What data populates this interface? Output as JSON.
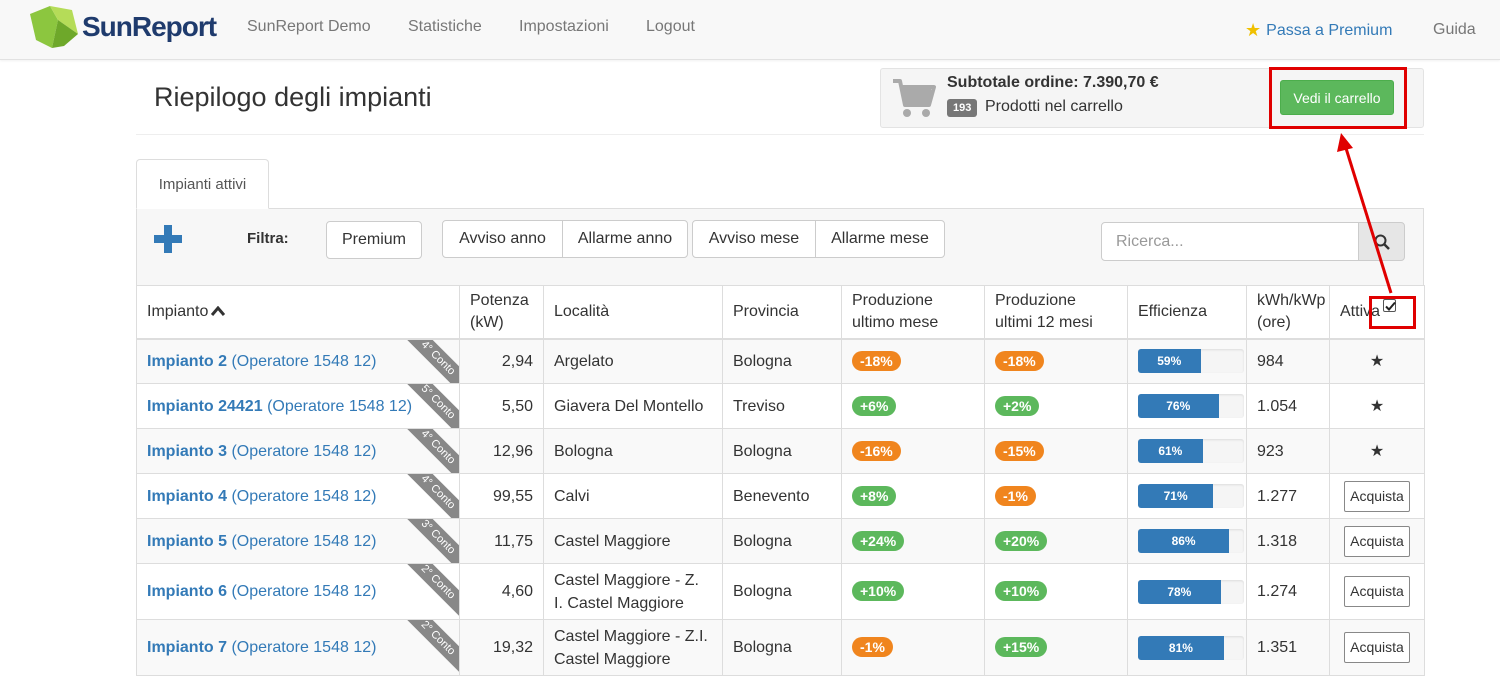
{
  "brand": {
    "name": "SunReport",
    "logo_icon": "sunreport-logo-icon"
  },
  "nav": {
    "items": [
      "SunReport Demo",
      "Statistiche",
      "Impostazioni",
      "Logout"
    ],
    "premium_label": "Passa a Premium",
    "guide_label": "Guida"
  },
  "page": {
    "title": "Riepilogo degli impianti"
  },
  "cart": {
    "subtotal_label": "Subtotale ordine: 7.390,70 €",
    "count": "193",
    "products_label": "Prodotti nel carrello",
    "button_label": "Vedi il carrello"
  },
  "tabs": [
    {
      "label": "Impianti attivi"
    }
  ],
  "filter": {
    "label": "Filtra:",
    "buttons": [
      "Premium",
      "Avviso anno",
      "Allarme anno",
      "Avviso mese",
      "Allarme mese"
    ]
  },
  "search": {
    "placeholder": "Ricerca..."
  },
  "table": {
    "headers": {
      "impianto": "Impianto",
      "potenza": "Potenza (kW)",
      "localita": "Località",
      "provincia": "Provincia",
      "prod_mese": "Produzione ultimo mese",
      "prod_anno": "Produzione ultimi 12 mesi",
      "efficienza": "Efficienza",
      "kwh": "kWh/kWp (ore)",
      "attiva": "Attiva"
    },
    "rows": [
      {
        "name": "Impianto 2",
        "operator": "(Operatore 1548 12)",
        "conto": "4° Conto",
        "potenza": "2,94",
        "localita": "Argelato",
        "provincia": "Bologna",
        "prod_mese": "-18%",
        "prod_anno": "-18%",
        "efficienza": 59,
        "efficienza_label": "59%",
        "kwh": "984",
        "attiva": "star"
      },
      {
        "name": "Impianto 24421",
        "operator": "(Operatore 1548 12)",
        "conto": "5° Conto",
        "potenza": "5,50",
        "localita": "Giavera Del Montello",
        "provincia": "Treviso",
        "prod_mese": "+6%",
        "prod_anno": "+2%",
        "efficienza": 76,
        "efficienza_label": "76%",
        "kwh": "1.054",
        "attiva": "star"
      },
      {
        "name": "Impianto 3",
        "operator": "(Operatore 1548 12)",
        "conto": "4° Conto",
        "potenza": "12,96",
        "localita": "Bologna",
        "provincia": "Bologna",
        "prod_mese": "-16%",
        "prod_anno": "-15%",
        "efficienza": 61,
        "efficienza_label": "61%",
        "kwh": "923",
        "attiva": "star"
      },
      {
        "name": "Impianto 4",
        "operator": "(Operatore 1548 12)",
        "conto": "4° Conto",
        "potenza": "99,55",
        "localita": "Calvi",
        "provincia": "Benevento",
        "prod_mese": "+8%",
        "prod_anno": "-1%",
        "efficienza": 71,
        "efficienza_label": "71%",
        "kwh": "1.277",
        "attiva": "Acquista"
      },
      {
        "name": "Impianto 5",
        "operator": "(Operatore 1548 12)",
        "conto": "3° Conto",
        "potenza": "11,75",
        "localita": "Castel Maggiore",
        "provincia": "Bologna",
        "prod_mese": "+24%",
        "prod_anno": "+20%",
        "efficienza": 86,
        "efficienza_label": "86%",
        "kwh": "1.318",
        "attiva": "Acquista"
      },
      {
        "name": "Impianto 6",
        "operator": "(Operatore 1548 12)",
        "conto": "2° Conto",
        "potenza": "4,60",
        "localita": "Castel Maggiore - Z. I. Castel Maggiore",
        "provincia": "Bologna",
        "prod_mese": "+10%",
        "prod_anno": "+10%",
        "efficienza": 78,
        "efficienza_label": "78%",
        "kwh": "1.274",
        "attiva": "Acquista"
      },
      {
        "name": "Impianto 7",
        "operator": "(Operatore 1548 12)",
        "conto": "2° Conto",
        "potenza": "19,32",
        "localita": "Castel Maggiore - Z.I. Castel Maggiore",
        "provincia": "Bologna",
        "prod_mese": "-1%",
        "prod_anno": "+15%",
        "efficienza": 81,
        "efficienza_label": "81%",
        "kwh": "1.351",
        "attiva": "Acquista"
      }
    ]
  },
  "colors": {
    "accent": "#337ab7",
    "success": "#5cb85c",
    "warning": "#f0851e",
    "highlight": "#e00000",
    "star": "#f0c000"
  }
}
